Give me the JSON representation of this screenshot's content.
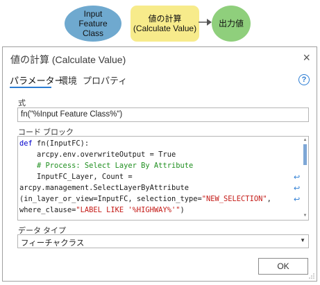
{
  "diagram": {
    "input_node": [
      "Input",
      "Feature",
      "Class"
    ],
    "tool_node": [
      "値の計算",
      "(Calculate Value)"
    ],
    "output_node": "出力値"
  },
  "dialog": {
    "title": "値の計算 (Calculate Value)",
    "close": "×",
    "tabs": [
      "パラメーター",
      "環境",
      "プロパティ"
    ],
    "active_tab": "パラメーター",
    "help": "?",
    "expression_label": "式",
    "expression_value": "fn(\"%Input Feature Class%\")",
    "code_block_label": "コード ブロック",
    "code_lines": [
      "def fn(InputFC):",
      "    arcpy.env.overwriteOutput = True",
      "    # Process: Select Layer By Attribute",
      "    InputFC_Layer, Count =",
      "arcpy.management.SelectLayerByAttribute",
      "(in_layer_or_view=InputFC, selection_type=\"NEW_SELECTION\",",
      "where_clause=\"LABEL LIKE '%HIGHWAY%'\")"
    ],
    "data_type_label": "データ タイプ",
    "data_type_value": "フィーチャクラス",
    "ok_label": "OK"
  },
  "colors": {
    "input_node": "#6fa9cf",
    "tool_node": "#f7eb8b",
    "output_node": "#8fcf7c",
    "accent": "#2b7cd3",
    "keyword": "#0000cc",
    "comment": "#1f8f1f",
    "string": "#c41a16"
  }
}
